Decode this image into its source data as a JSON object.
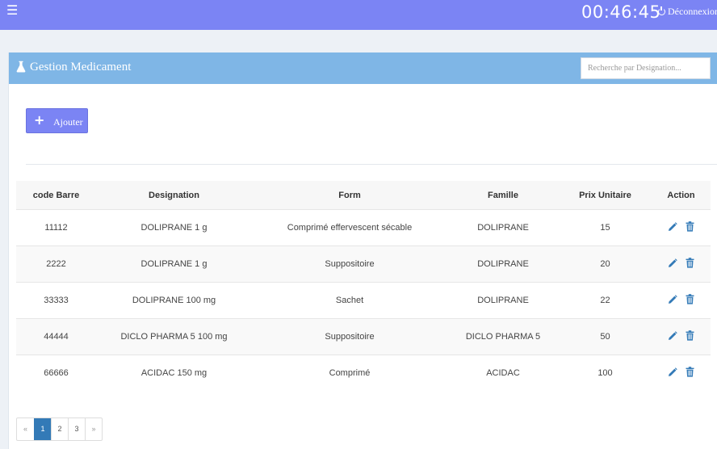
{
  "header": {
    "menu_icon": "hamburger-icon",
    "clock": "00:46:45",
    "logout_label": "Déconnexion",
    "logout_icon": "power-icon",
    "bar_color": "#7b84f4"
  },
  "panel": {
    "title": "Gestion Medicament",
    "title_icon": "flask-icon",
    "search_placeholder": "Recherche par Designation...",
    "header_color": "#7fb6e6"
  },
  "actions": {
    "add_label": "Ajouter",
    "add_icon": "plus-icon"
  },
  "table": {
    "columns": [
      "code Barre",
      "Designation",
      "Form",
      "Famille",
      "Prix Unitaire",
      "Action"
    ],
    "rows": [
      {
        "code": "11112",
        "designation": "DOLIPRANE 1 g",
        "form": "Comprimé effervescent sécable",
        "famille": "DOLIPRANE",
        "prix": "15"
      },
      {
        "code": "2222",
        "designation": "DOLIPRANE 1 g",
        "form": "Suppositoire",
        "famille": "DOLIPRANE",
        "prix": "20"
      },
      {
        "code": "33333",
        "designation": "DOLIPRANE 100 mg",
        "form": "Sachet",
        "famille": "DOLIPRANE",
        "prix": "22"
      },
      {
        "code": "44444",
        "designation": "DICLO PHARMA 5 100 mg",
        "form": "Suppositoire",
        "famille": "DICLO PHARMA 5",
        "prix": "50"
      },
      {
        "code": "66666",
        "designation": "ACIDAC 150 mg",
        "form": "Comprimé",
        "famille": "ACIDAC",
        "prix": "100"
      }
    ],
    "row_icons": [
      "pencil-icon",
      "trash-icon"
    ]
  },
  "pagination": {
    "prev": "«",
    "pages": [
      "1",
      "2",
      "3"
    ],
    "next": "»",
    "active": "1"
  }
}
